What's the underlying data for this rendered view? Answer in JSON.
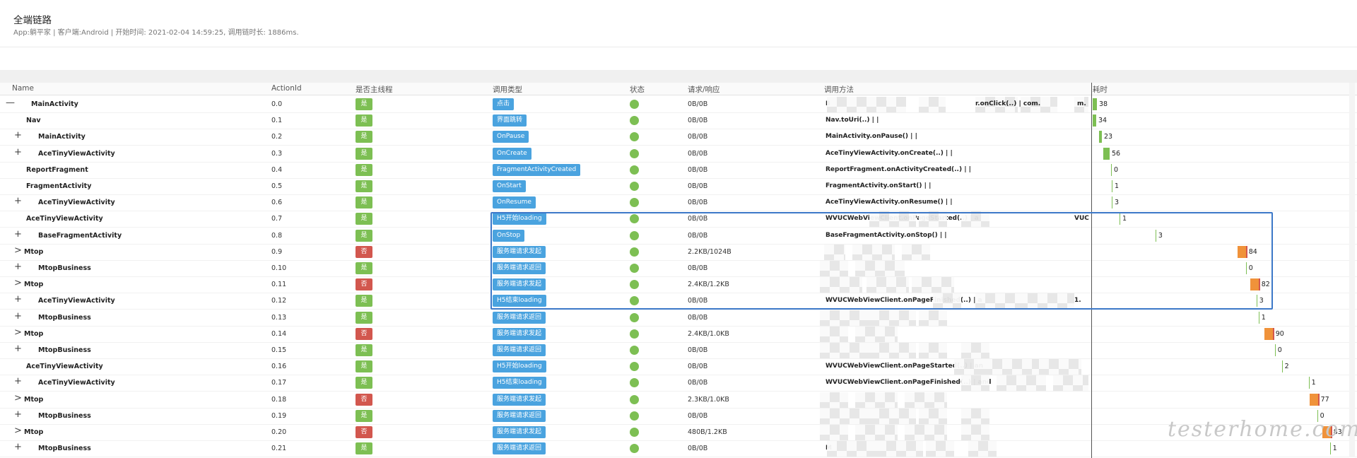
{
  "header": {
    "title": "全端链路",
    "subtitle": "App:躺平家 | 客户端:Android | 开始时间: 2021-02-04 14:59:25, 调用链时长: 1886ms."
  },
  "table": {
    "columns": {
      "name": "Name",
      "action_id": "ActionId",
      "main_thread": "是否主线程",
      "call_type": "调用类型",
      "status": "状态",
      "req_resp": "请求/响应",
      "method": "调用方法",
      "duration": "耗时"
    },
    "rows": [
      {
        "toggle": "—",
        "name": "MainActivity",
        "id": "0.0",
        "main": "是",
        "type": "点击",
        "size": "0B/0B",
        "method": "B",
        "method2": "r.onClick(..) | com.",
        "method3": "m.",
        "dur": "38",
        "color": "green"
      },
      {
        "toggle": "",
        "name": "Nav",
        "id": "0.1",
        "main": "是",
        "type": "界面跳转",
        "size": "0B/0B",
        "method": "Nav.toUri(..) | |",
        "dur": "34",
        "color": "green"
      },
      {
        "toggle": "+",
        "name": "MainActivity",
        "id": "0.2",
        "main": "是",
        "type": "OnPause",
        "size": "0B/0B",
        "method": "MainActivity.onPause() | |",
        "dur": "23",
        "color": "green"
      },
      {
        "toggle": "+",
        "name": "AceTinyViewActivity",
        "id": "0.3",
        "main": "是",
        "type": "OnCreate",
        "size": "0B/0B",
        "method": "AceTinyViewActivity.onCreate(..) | |",
        "dur": "56",
        "color": "green"
      },
      {
        "toggle": "",
        "name": "ReportFragment",
        "id": "0.4",
        "main": "是",
        "type": "FragmentActivityCreated",
        "size": "0B/0B",
        "method": "ReportFragment.onActivityCreated(..) | |",
        "dur": "0",
        "color": "green"
      },
      {
        "toggle": "",
        "name": "FragmentActivity",
        "id": "0.5",
        "main": "是",
        "type": "OnStart",
        "size": "0B/0B",
        "method": "FragmentActivity.onStart() | |",
        "dur": "1",
        "color": "green"
      },
      {
        "toggle": "+",
        "name": "AceTinyViewActivity",
        "id": "0.6",
        "main": "是",
        "type": "OnResume",
        "size": "0B/0B",
        "method": "AceTinyViewActivity.onResume() | |",
        "dur": "3",
        "color": "green"
      },
      {
        "toggle": "",
        "name": "AceTinyViewActivity",
        "id": "0.7",
        "main": "是",
        "type": "H5开始loading",
        "size": "0B/0B",
        "method": "WVUCWebViewClient.onPageStarted(..) | a",
        "method3": "VUC",
        "dur": "1",
        "color": "green"
      },
      {
        "toggle": "+",
        "name": "BaseFragmentActivity",
        "id": "0.8",
        "main": "是",
        "type": "OnStop",
        "size": "0B/0B",
        "method": "BaseFragmentActivity.onStop() | |",
        "dur": "3",
        "color": "green"
      },
      {
        "toggle": ">",
        "name": "Mtop",
        "id": "0.9",
        "main": "否",
        "type": "服务端请求发起",
        "size": "2.2KB/1024B",
        "method": "",
        "dur": "84",
        "color": "orange"
      },
      {
        "toggle": "+",
        "name": "MtopBusiness",
        "id": "0.10",
        "main": "是",
        "type": "服务端请求返回",
        "size": "0B/0B",
        "method": "",
        "dur": "0",
        "color": "green"
      },
      {
        "toggle": ">",
        "name": "Mtop",
        "id": "0.11",
        "main": "否",
        "type": "服务端请求发起",
        "size": "2.4KB/1.2KB",
        "method": "",
        "dur": "82",
        "color": "orange"
      },
      {
        "toggle": "+",
        "name": "AceTinyViewActivity",
        "id": "0.12",
        "main": "是",
        "type": "H5结束loading",
        "size": "0B/0B",
        "method": "WVUCWebViewClient.onPageFinished(..) | a",
        "method3": "1.",
        "dur": "3",
        "color": "green"
      },
      {
        "toggle": "+",
        "name": "MtopBusiness",
        "id": "0.13",
        "main": "是",
        "type": "服务端请求返回",
        "size": "0B/0B",
        "method": "",
        "dur": "1",
        "color": "green"
      },
      {
        "toggle": ">",
        "name": "Mtop",
        "id": "0.14",
        "main": "否",
        "type": "服务端请求发起",
        "size": "2.4KB/1.0KB",
        "method": "",
        "dur": "90",
        "color": "orange"
      },
      {
        "toggle": "+",
        "name": "MtopBusiness",
        "id": "0.15",
        "main": "是",
        "type": "服务端请求返回",
        "size": "0B/0B",
        "method": "",
        "dur": "0",
        "color": "green"
      },
      {
        "toggle": "",
        "name": "AceTinyViewActivity",
        "id": "0.16",
        "main": "是",
        "type": "H5开始loading",
        "size": "0B/0B",
        "method": "WVUCWebViewClient.onPageStarted(..) | an",
        "dur": "2",
        "color": "green"
      },
      {
        "toggle": "+",
        "name": "AceTinyViewActivity",
        "id": "0.17",
        "main": "是",
        "type": "H5结束loading",
        "size": "0B/0B",
        "method": "WVUCWebViewClient.onPageFinished(..) | and",
        "dur": "1",
        "color": "green"
      },
      {
        "toggle": ">",
        "name": "Mtop",
        "id": "0.18",
        "main": "否",
        "type": "服务端请求发起",
        "size": "2.3KB/1.0KB",
        "method": "",
        "dur": "77",
        "color": "orange"
      },
      {
        "toggle": "+",
        "name": "MtopBusiness",
        "id": "0.19",
        "main": "是",
        "type": "服务端请求返回",
        "size": "0B/0B",
        "method": "",
        "dur": "0",
        "color": "green"
      },
      {
        "toggle": ">",
        "name": "Mtop",
        "id": "0.20",
        "main": "否",
        "type": "服务端请求发起",
        "size": "480B/1.2KB",
        "method": "",
        "dur": "83",
        "color": "orange"
      },
      {
        "toggle": "+",
        "name": "MtopBusiness",
        "id": "0.21",
        "main": "是",
        "type": "服务端请求返回",
        "size": "0B/0B",
        "method": "M",
        "dur": "1",
        "color": "green"
      }
    ]
  },
  "watermark": "testerhome.com",
  "colors": {
    "green": "#7dbf53",
    "red": "#d2574e",
    "blue": "#4aa3df",
    "orange": "#f0923a",
    "highlight": "#3c78c8"
  }
}
